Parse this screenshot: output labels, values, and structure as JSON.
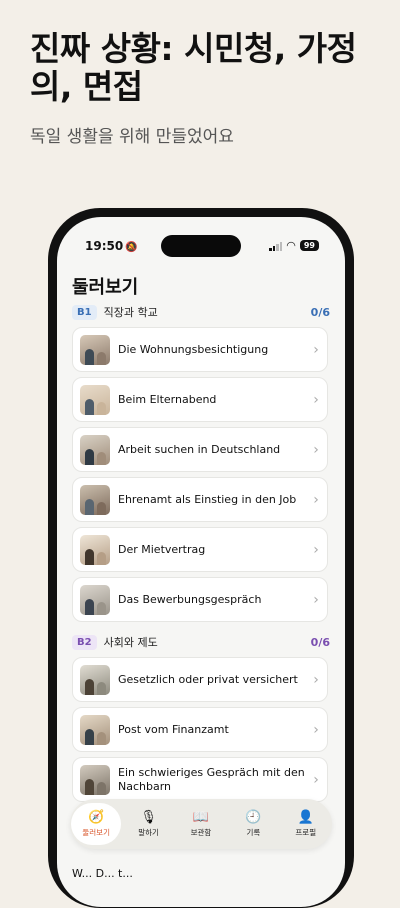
{
  "headline": "진짜 상황: 시민청, 가정의, 면접",
  "subheadline": "독일 생활을 위해 만들었어요",
  "status_bar": {
    "time": "19:50",
    "battery": "99"
  },
  "page_title": "둘러보기",
  "sections": [
    {
      "level": "B1",
      "title": "직장과 학교",
      "progress": "0/6",
      "badge_bg": "#e3ecf7",
      "badge_fg": "#3a6fb5",
      "progress_color": "#3a6fb5",
      "items": [
        {
          "label": "Die Wohnungsbesichtigung"
        },
        {
          "label": "Beim Elternabend"
        },
        {
          "label": "Arbeit suchen in Deutschland"
        },
        {
          "label": "Ehrenamt als Einstieg in den Job"
        },
        {
          "label": "Der Mietvertrag"
        },
        {
          "label": "Das Bewerbungsgespräch"
        }
      ]
    },
    {
      "level": "B2",
      "title": "사회와 제도",
      "progress": "0/6",
      "badge_bg": "#ede5f6",
      "badge_fg": "#7a4fb0",
      "progress_color": "#7a4fb0",
      "items": [
        {
          "label": "Gesetzlich oder privat versichert"
        },
        {
          "label": "Post vom Finanzamt"
        },
        {
          "label": "Ein schwieriges Gespräch mit den Nachbarn"
        }
      ]
    }
  ],
  "peek_text": "W... D... t...",
  "tabs": [
    {
      "label": "둘러보기",
      "icon": "compass-icon",
      "active": true
    },
    {
      "label": "말하기",
      "icon": "microphone-icon",
      "active": false
    },
    {
      "label": "보관함",
      "icon": "book-icon",
      "active": false
    },
    {
      "label": "기록",
      "icon": "clock-icon",
      "active": false
    },
    {
      "label": "프로필",
      "icon": "person-icon",
      "active": false
    }
  ],
  "colors": {
    "accent": "#d9542a",
    "background": "#f3efe8"
  }
}
